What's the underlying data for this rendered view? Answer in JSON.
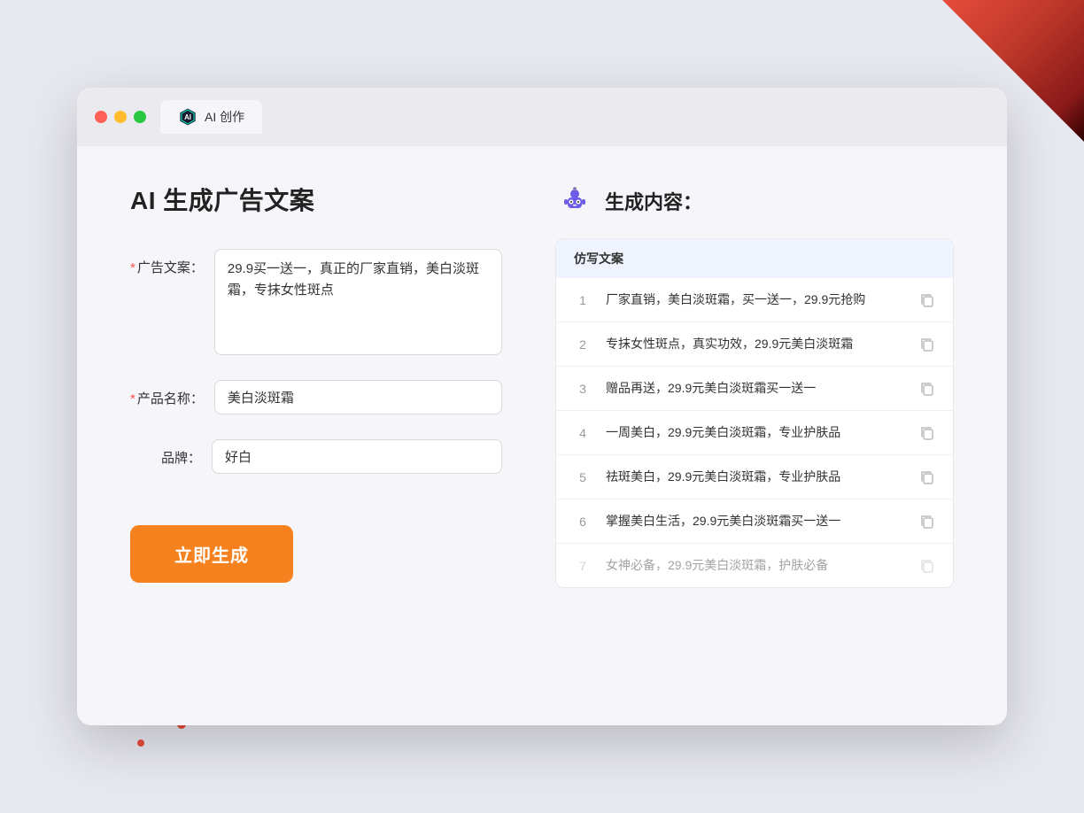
{
  "window": {
    "tab_label": "AI 创作"
  },
  "page": {
    "title": "AI 生成广告文案"
  },
  "form": {
    "ad_copy_label": "广告文案：",
    "ad_copy_required": "*",
    "ad_copy_value": "29.9买一送一，真正的厂家直销，美白淡斑霜，专抹女性斑点",
    "product_name_label": "产品名称：",
    "product_name_required": "*",
    "product_name_value": "美白淡斑霜",
    "brand_label": "品牌：",
    "brand_value": "好白",
    "generate_button": "立即生成"
  },
  "results": {
    "header_title": "生成内容：",
    "column_label": "仿写文案",
    "items": [
      {
        "number": "1",
        "text": "厂家直销，美白淡斑霜，买一送一，29.9元抢购",
        "dimmed": false
      },
      {
        "number": "2",
        "text": "专抹女性斑点，真实功效，29.9元美白淡斑霜",
        "dimmed": false
      },
      {
        "number": "3",
        "text": "赠品再送，29.9元美白淡斑霜买一送一",
        "dimmed": false
      },
      {
        "number": "4",
        "text": "一周美白，29.9元美白淡斑霜，专业护肤品",
        "dimmed": false
      },
      {
        "number": "5",
        "text": "祛斑美白，29.9元美白淡斑霜，专业护肤品",
        "dimmed": false
      },
      {
        "number": "6",
        "text": "掌握美白生活，29.9元美白淡斑霜买一送一",
        "dimmed": false
      },
      {
        "number": "7",
        "text": "女神必备，29.9元美白淡斑霜，护肤必备",
        "dimmed": true
      }
    ]
  }
}
